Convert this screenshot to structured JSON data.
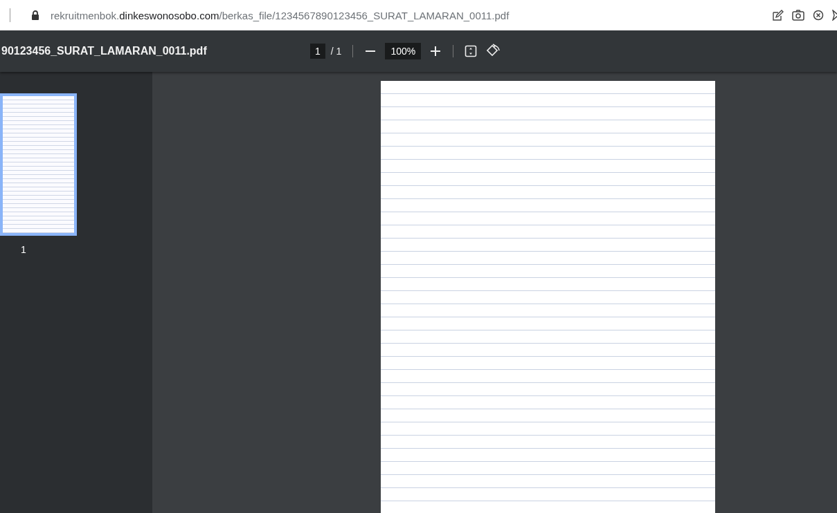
{
  "address_bar": {
    "url_parts": [
      {
        "text": "rekruitmenbok.",
        "emphasis": false
      },
      {
        "text": "dinkeswonosobo.com",
        "emphasis": true
      },
      {
        "text": "/berkas_file/1234567890123456_SURAT_LAMARAN_0011.pdf",
        "emphasis": false
      }
    ],
    "secure": true
  },
  "toolbar": {
    "title": "90123456_SURAT_LAMARAN_0011.pdf",
    "page_value": "1",
    "page_total": "/ 1",
    "zoom_value": "100%"
  },
  "thumbnails": [
    {
      "label": "1",
      "selected": true
    }
  ]
}
